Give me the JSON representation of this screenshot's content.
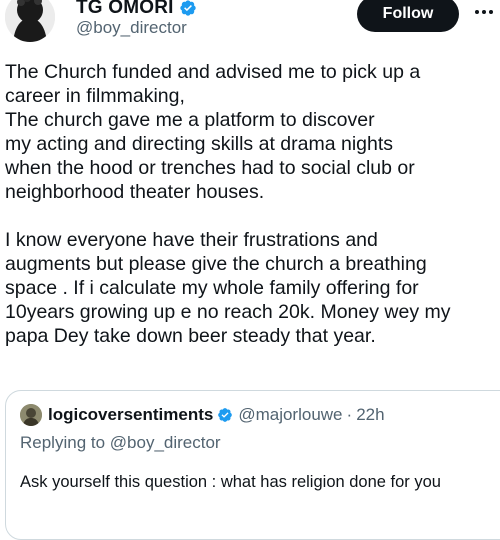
{
  "author": {
    "display_name": "TG OMORI",
    "handle": "@boy_director",
    "verified_icon": "verified-badge-icon",
    "avatar_icon": "profile-avatar"
  },
  "actions": {
    "follow_label": "Follow",
    "more_icon": "more-options-icon"
  },
  "tweet": {
    "paragraph_1": "The Church funded and advised me to pick up a\ncareer in filmmaking,\nThe church gave me a platform to discover\nmy acting and directing skills at drama nights\nwhen the hood or trenches had to social club or\nneighborhood theater houses.",
    "paragraph_2": "I know everyone have their frustrations and\naugments but please give the church a breathing\nspace . If i calculate my whole family offering for\n10years growing up e no reach 20k. Money wey my\npapa Dey take down beer steady that year."
  },
  "quoted_tweet": {
    "display_name": "logicoversentiments",
    "handle": "@majorlouwe",
    "separator": "·",
    "time": "22h",
    "replying_to": "Replying to @boy_director",
    "text": "Ask yourself this question : what has religion done for you"
  },
  "colors": {
    "text_primary": "#0f1419",
    "text_secondary": "#536471",
    "verified_blue": "#1d9bf0",
    "follow_bg": "#0f1419",
    "card_border": "#cfd9de"
  }
}
